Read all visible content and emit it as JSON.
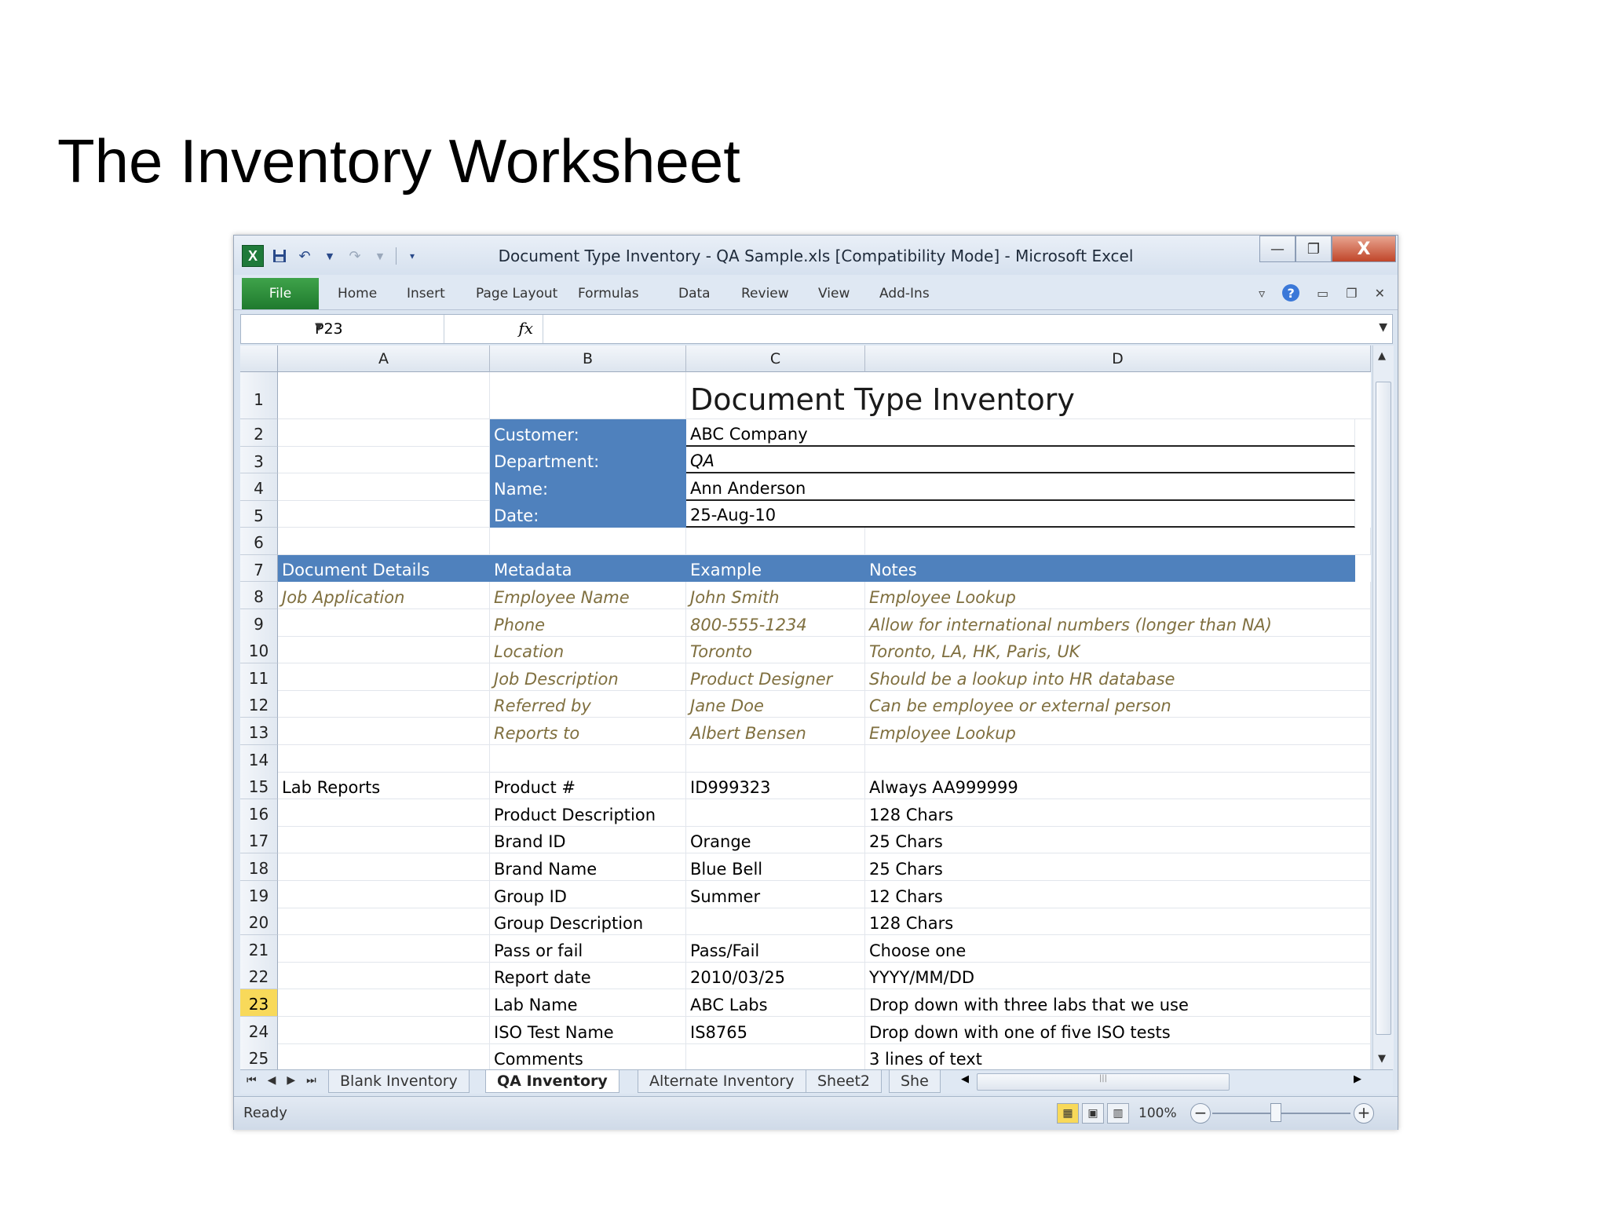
{
  "slide": {
    "title": "The Inventory Worksheet"
  },
  "window": {
    "title": "Document Type Inventory - QA Sample.xls  [Compatibility Mode]  -  Microsoft Excel",
    "controls": {
      "minimize": "—",
      "restore": "❐",
      "close": "X"
    }
  },
  "ribbon": {
    "file": "File",
    "tabs": [
      "Home",
      "Insert",
      "Page Layout",
      "Formulas",
      "Data",
      "Review",
      "View",
      "Add-Ins"
    ]
  },
  "formula_bar": {
    "name_box": "P23",
    "fx": "fx",
    "value": ""
  },
  "columns": [
    "A",
    "B",
    "C",
    "D"
  ],
  "selected_row": "23",
  "header_block": {
    "title": "Document Type Inventory",
    "fields": [
      {
        "label": "Customer:",
        "value": "ABC Company"
      },
      {
        "label": "Department:",
        "value": "QA"
      },
      {
        "label": "Name:",
        "value": "Ann Anderson"
      },
      {
        "label": "Date:",
        "value": "25-Aug-10"
      }
    ]
  },
  "table_header": [
    "Document Details",
    "Metadata",
    "Example",
    "Notes"
  ],
  "rows": [
    {
      "n": "8",
      "a": "Job Application",
      "b": "Employee Name",
      "c": "John Smith",
      "d": "Employee Lookup"
    },
    {
      "n": "9",
      "a": "",
      "b": "Phone",
      "c": "800-555-1234",
      "d": "Allow for international numbers (longer than NA)"
    },
    {
      "n": "10",
      "a": "",
      "b": "Location",
      "c": "Toronto",
      "d": "Toronto, LA, HK, Paris, UK"
    },
    {
      "n": "11",
      "a": "",
      "b": "Job Description",
      "c": "Product Designer",
      "d": "Should be a lookup into HR database"
    },
    {
      "n": "12",
      "a": "",
      "b": "Referred by",
      "c": "Jane Doe",
      "d": "Can be employee or external person"
    },
    {
      "n": "13",
      "a": "",
      "b": "Reports to",
      "c": "Albert Bensen",
      "d": "Employee Lookup"
    },
    {
      "n": "14",
      "a": "",
      "b": "",
      "c": "",
      "d": ""
    },
    {
      "n": "15",
      "a": "Lab Reports",
      "b": "Product #",
      "c": "ID999323",
      "d": "Always AA999999"
    },
    {
      "n": "16",
      "a": "",
      "b": "Product Description",
      "c": "",
      "d": "128 Chars"
    },
    {
      "n": "17",
      "a": "",
      "b": "Brand ID",
      "c": "Orange",
      "d": "25 Chars"
    },
    {
      "n": "18",
      "a": "",
      "b": "Brand Name",
      "c": "Blue Bell",
      "d": "25 Chars"
    },
    {
      "n": "19",
      "a": "",
      "b": "Group ID",
      "c": "Summer",
      "d": "12 Chars"
    },
    {
      "n": "20",
      "a": "",
      "b": "Group Description",
      "c": "",
      "d": "128 Chars"
    },
    {
      "n": "21",
      "a": "",
      "b": "Pass or fail",
      "c": "Pass/Fail",
      "d": "Choose one"
    },
    {
      "n": "22",
      "a": "",
      "b": "Report date",
      "c": "2010/03/25",
      "d": "YYYY/MM/DD"
    },
    {
      "n": "23",
      "a": "",
      "b": "Lab Name",
      "c": "ABC Labs",
      "d": "Drop down with three labs that we use"
    },
    {
      "n": "24",
      "a": "",
      "b": "ISO Test Name",
      "c": "IS8765",
      "d": "Drop down with one of five ISO tests"
    },
    {
      "n": "25",
      "a": "",
      "b": "Comments",
      "c": "",
      "d": "3 lines of text"
    }
  ],
  "sheet_tabs": [
    "Blank Inventory",
    "QA Inventory",
    "Alternate Inventory",
    "Sheet2",
    "She"
  ],
  "active_sheet": "QA Inventory",
  "status": {
    "ready": "Ready",
    "zoom": "100%"
  },
  "colors": {
    "header_blue": "#4f81bd",
    "selected_row": "#f8d95a",
    "file_tab": "#1f7a2e"
  }
}
